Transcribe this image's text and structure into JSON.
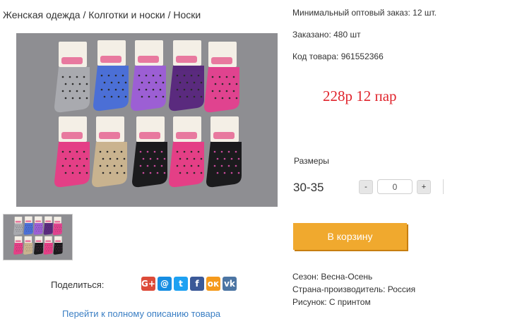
{
  "breadcrumb": {
    "items": [
      "Женская одежда",
      "Колготки и носки",
      "Носки"
    ],
    "separator": " / "
  },
  "product": {
    "min_order": "Минимальный оптовый заказ: 12 шт.",
    "ordered": "Заказано: 480 шт",
    "code": "Код товара: 961552366",
    "price": "228р 12 пар",
    "sizes_label": "Размеры",
    "size": "30-35",
    "quantity": "0",
    "minus_label": "-",
    "plus_label": "+",
    "cart_label": "В корзину",
    "season": "Сезон: Весна-Осень",
    "country": "Страна-производитель: Россия",
    "pattern": "Рисунок: С принтом"
  },
  "share": {
    "label": "Поделиться:",
    "buttons": [
      {
        "icon": "google-plus-icon",
        "glyph": "G+",
        "color": "#dd4b39"
      },
      {
        "icon": "mail-icon",
        "glyph": "@",
        "color": "#168de2"
      },
      {
        "icon": "twitter-icon",
        "glyph": "t",
        "color": "#1da1f2"
      },
      {
        "icon": "facebook-icon",
        "glyph": "f",
        "color": "#3b5998"
      },
      {
        "icon": "odnoklassniki-icon",
        "glyph": "ок",
        "color": "#f59a1c"
      },
      {
        "icon": "vk-icon",
        "glyph": "vk",
        "color": "#4c75a3"
      }
    ]
  },
  "full_description_link": "Перейти к полному описанию товара",
  "colors": {
    "price": "#e0242c",
    "cart_button": "#f0a92e",
    "link": "#3b7fc4",
    "photo_background": "#8e8e92"
  },
  "image": {
    "subject": "socks-product-photo",
    "sock_colors": [
      "#a9aaaf",
      "#4b6fd6",
      "#9c5fd4",
      "#5a2a7e",
      "#e0438f",
      "#e43f86",
      "#c9b38f",
      "#1b1b1d",
      "#e43f86",
      "#1b1b1d"
    ]
  }
}
